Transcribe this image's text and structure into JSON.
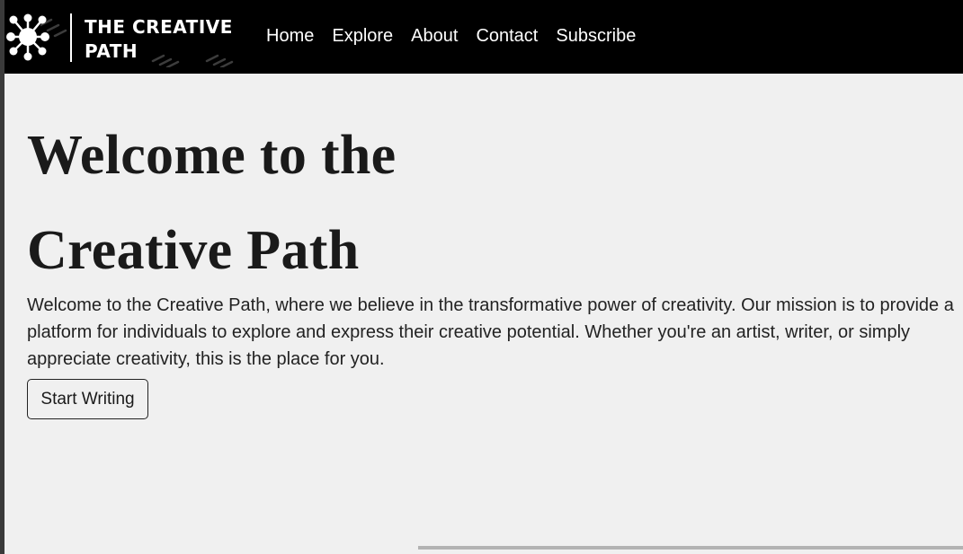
{
  "brand": {
    "line1": "THE CREATIVE",
    "line2": "PATH",
    "logo_icon": "network-icon"
  },
  "nav": {
    "items": [
      {
        "label": "Home"
      },
      {
        "label": "Explore"
      },
      {
        "label": "About"
      },
      {
        "label": "Contact"
      },
      {
        "label": "Subscribe"
      }
    ]
  },
  "hero": {
    "title_line1": "Welcome to the",
    "title_line2": "Creative Path",
    "description": "Welcome to the Creative Path, where we believe in the transformative power of creativity. Our mission is to provide a platform for individuals to explore and express their creative potential. Whether you're an artist, writer, or simply appreciate creativity, this is the place for you.",
    "button_label": "Start Writing"
  },
  "colors": {
    "navbar_bg": "#000000",
    "page_bg": "#f0f0f0",
    "text": "#1a1a1a"
  }
}
